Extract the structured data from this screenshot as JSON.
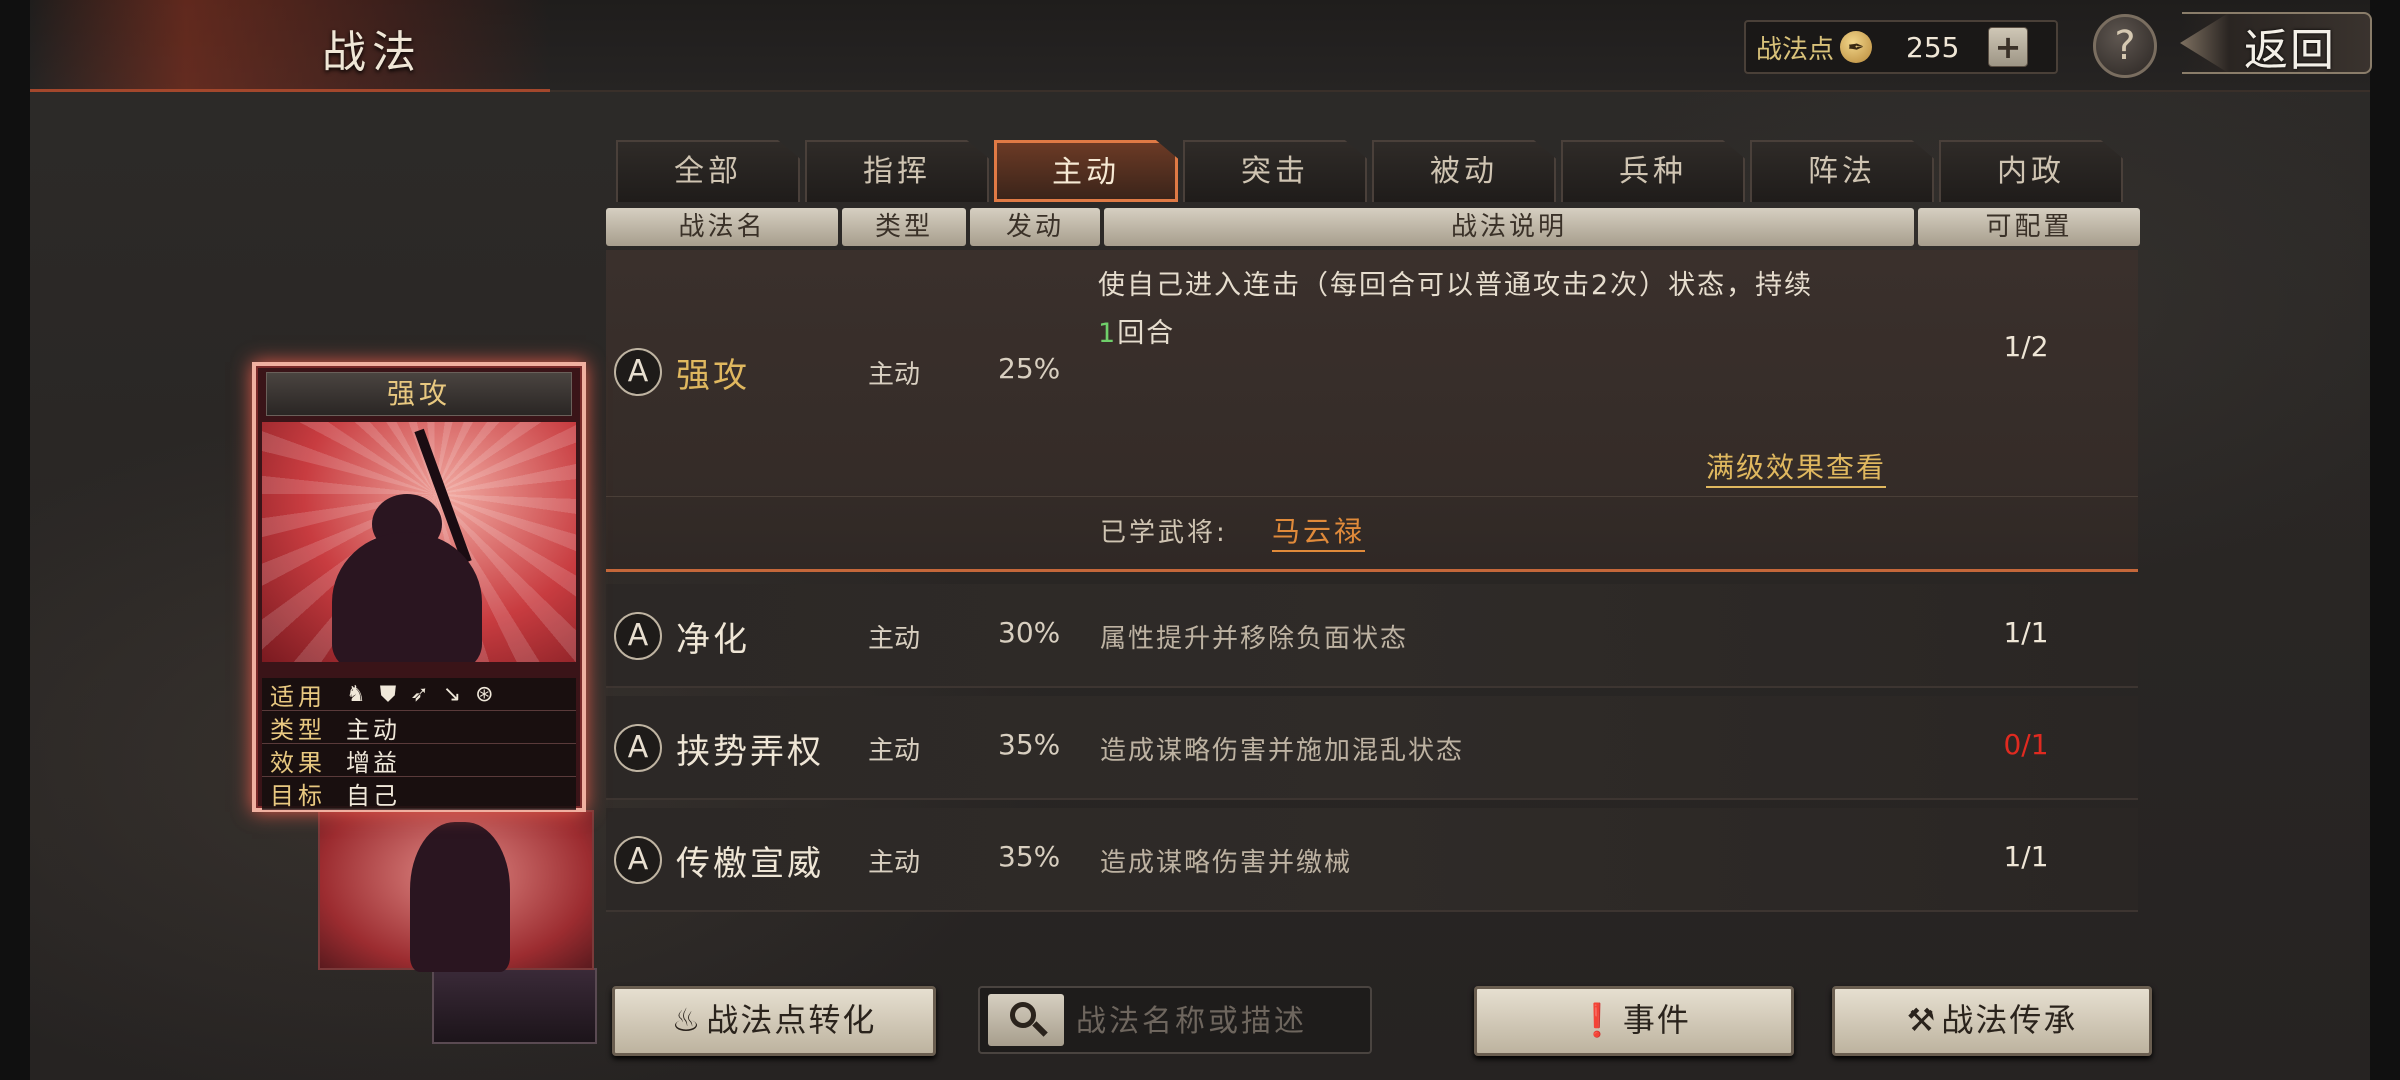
{
  "header": {
    "title": "战法",
    "points_label": "战法点",
    "points_value": "255",
    "plus_label": "+",
    "help_label": "?",
    "back_label": "返回"
  },
  "tabs": [
    {
      "label": "全部",
      "active": false
    },
    {
      "label": "指挥",
      "active": false
    },
    {
      "label": "主动",
      "active": true
    },
    {
      "label": "突击",
      "active": false
    },
    {
      "label": "被动",
      "active": false
    },
    {
      "label": "兵种",
      "active": false
    },
    {
      "label": "阵法",
      "active": false
    },
    {
      "label": "内政",
      "active": false
    }
  ],
  "columns": {
    "name": "战法名",
    "type": "类型",
    "rate": "发动",
    "desc": "战法说明",
    "quota": "可配置"
  },
  "expanded_skill": {
    "grade": "A",
    "name": "强攻",
    "type": "主动",
    "rate": "25%",
    "desc_line1": "使自己进入连击（每回合可以普通攻击2次）状态，持续",
    "desc_line2_num": "1",
    "desc_line2_rest": "回合",
    "quota": "1/2",
    "full_effect_link": "满级效果查看",
    "learned_label": "已学武将:",
    "learned_general": "马云禄"
  },
  "skills": [
    {
      "grade": "A",
      "name": "净化",
      "type": "主动",
      "rate": "30%",
      "desc": "属性提升并移除负面状态",
      "quota": "1/1"
    },
    {
      "grade": "A",
      "name": "挟势弄权",
      "type": "主动",
      "rate": "35%",
      "desc": "造成谋略伤害并施加混乱状态",
      "quota": "0/1"
    },
    {
      "grade": "A",
      "name": "传檄宣威",
      "type": "主动",
      "rate": "35%",
      "desc": "造成谋略伤害并缴械",
      "quota": "1/1"
    }
  ],
  "card": {
    "title": "强攻",
    "applies_label": "适用",
    "troop_icons": [
      "cavalry-icon",
      "shield-icon",
      "bow-icon",
      "spear-icon",
      "wheel-icon"
    ],
    "type_label": "类型",
    "type_value": "主动",
    "effect_label": "效果",
    "effect_value": "增益",
    "target_label": "目标",
    "target_value": "自己"
  },
  "bottom": {
    "convert_button": "战法点转化",
    "search_placeholder": "战法名称或描述",
    "events_button": "事件",
    "inherit_button": "战法传承"
  },
  "colors": {
    "accent_orange": "#e07a45",
    "gold_text": "#e0b85f",
    "general_link": "#e08a3a",
    "quota_zero": "#e02a20"
  }
}
